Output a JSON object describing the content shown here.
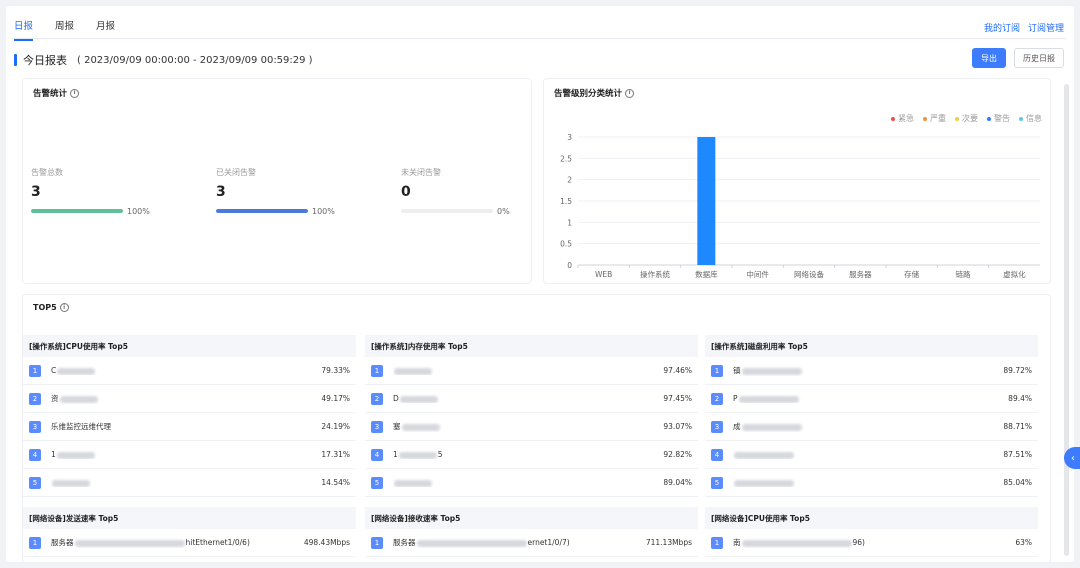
{
  "tabs": [
    "日报",
    "周报",
    "月报"
  ],
  "top_links": [
    "我的订阅",
    "订阅管理"
  ],
  "title": "今日报表",
  "time_range": "( 2023/09/09 00:00:00 - 2023/09/09 00:59:29 )",
  "buttons": {
    "export": "导出",
    "history": "历史日报"
  },
  "alarm_stats": {
    "title": "告警统计",
    "items": [
      {
        "label": "告警总数",
        "value": "3",
        "percent_text": "100%",
        "fraction": 1.0,
        "color": "#5fbf9a"
      },
      {
        "label": "已关闭告警",
        "value": "3",
        "percent_text": "100%",
        "fraction": 1.0,
        "color": "#4d79d9"
      },
      {
        "label": "未关闭告警",
        "value": "0",
        "percent_text": "0%",
        "fraction": 0.0,
        "color": "#cccccc"
      }
    ]
  },
  "chart_data": {
    "type": "bar",
    "title": "告警级别分类统计",
    "categories": [
      "WEB",
      "操作系统",
      "数据库",
      "中间件",
      "网络设备",
      "服务器",
      "存储",
      "链路",
      "虚拟化"
    ],
    "values": [
      0,
      0,
      3,
      0,
      0,
      0,
      0,
      0,
      0
    ],
    "ylim": [
      0,
      3
    ],
    "yticks": [
      "0",
      "0.5",
      "1",
      "1.5",
      "2",
      "2.5",
      "3"
    ],
    "bar_color": "#1e88ff",
    "grid": true,
    "legend": [
      {
        "name": "紧急",
        "color": "#f0504b"
      },
      {
        "name": "严重",
        "color": "#f5903c"
      },
      {
        "name": "次要",
        "color": "#f5cc3c"
      },
      {
        "name": "警告",
        "color": "#2d7bf5"
      },
      {
        "name": "信息",
        "color": "#5fc6f0"
      }
    ]
  },
  "top5": {
    "title": "TOP5",
    "panels": [
      {
        "title": "[操作系统]CPU使用率 Top5",
        "rows": [
          {
            "rank": "1",
            "name": "C",
            "value": "79.33%"
          },
          {
            "rank": "2",
            "name": "资",
            "value": "49.17%"
          },
          {
            "rank": "3",
            "name": "乐维监控远维代理",
            "value": "24.19%"
          },
          {
            "rank": "4",
            "name": "1",
            "value": "17.31%"
          },
          {
            "rank": "5",
            "name": "",
            "value": "14.54%"
          }
        ]
      },
      {
        "title": "[操作系统]内存使用率 Top5",
        "rows": [
          {
            "rank": "1",
            "name": "",
            "value": "97.46%"
          },
          {
            "rank": "2",
            "name": "D",
            "value": "97.45%"
          },
          {
            "rank": "3",
            "name": "塞",
            "value": "93.07%"
          },
          {
            "rank": "4",
            "name": "1",
            "suffix": "5",
            "value": "92.82%"
          },
          {
            "rank": "5",
            "name": "",
            "value": "89.04%"
          }
        ]
      },
      {
        "title": "[操作系统]磁盘利用率 Top5",
        "rows": [
          {
            "rank": "1",
            "name": "镇",
            "value": "89.72%"
          },
          {
            "rank": "2",
            "name": "P",
            "value": "89.4%"
          },
          {
            "rank": "3",
            "name": "成",
            "value": "88.71%"
          },
          {
            "rank": "4",
            "name": "",
            "value": "87.51%"
          },
          {
            "rank": "5",
            "name": "",
            "value": "85.04%"
          }
        ]
      },
      {
        "title": "[网络设备]发送速率 Top5",
        "rows": [
          {
            "rank": "1",
            "name": "服务器",
            "suffix": "hitEthernet1/0/6)",
            "value": "498.43Mbps"
          }
        ]
      },
      {
        "title": "[网络设备]接收速率 Top5",
        "rows": [
          {
            "rank": "1",
            "name": "服务器",
            "suffix": "ernet1/0/7)",
            "value": "711.13Mbps"
          }
        ]
      },
      {
        "title": "[网络设备]CPU使用率 Top5",
        "rows": [
          {
            "rank": "1",
            "name": "南",
            "suffix": "96)",
            "value": "63%"
          }
        ]
      }
    ]
  }
}
